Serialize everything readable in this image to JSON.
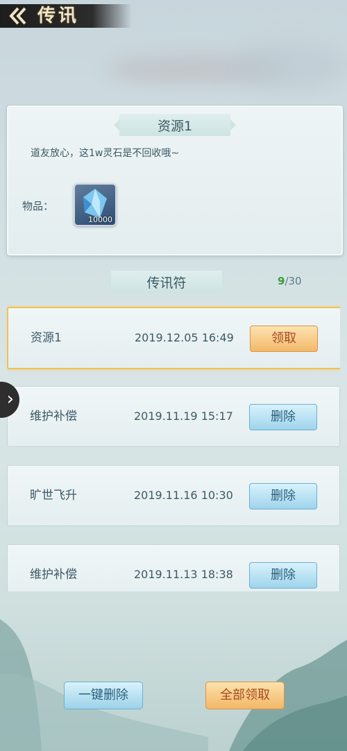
{
  "header": {
    "back_icon": "back-arrow-icon",
    "title": "传讯"
  },
  "detail": {
    "title": "资源1",
    "message": "道友放心，这1w灵石是不回收哦~",
    "items_label": "物品：",
    "item": {
      "icon": "spirit-crystal-icon",
      "count": "10000"
    }
  },
  "list_header": {
    "title": "传讯符",
    "current": "9",
    "total": "/30"
  },
  "messages": [
    {
      "title": "资源1",
      "date": "2019.12.05 16:49",
      "action": "领取"
    },
    {
      "title": "维护补偿",
      "date": "2019.11.19 15:17",
      "action": "删除"
    },
    {
      "title": "旷世飞升",
      "date": "2019.11.16 10:30",
      "action": "删除"
    },
    {
      "title": "维护补偿",
      "date": "2019.11.13 18:38",
      "action": "删除"
    }
  ],
  "side_toggle_icon": "chevron-right-icon",
  "bottom": {
    "delete_all": "一键删除",
    "claim_all": "全部领取"
  },
  "colors": {
    "claim_button": "#f2b96a",
    "delete_button": "#9fd4ec",
    "selected_border": "#f2c14e",
    "count_current": "#3a9a3a"
  }
}
